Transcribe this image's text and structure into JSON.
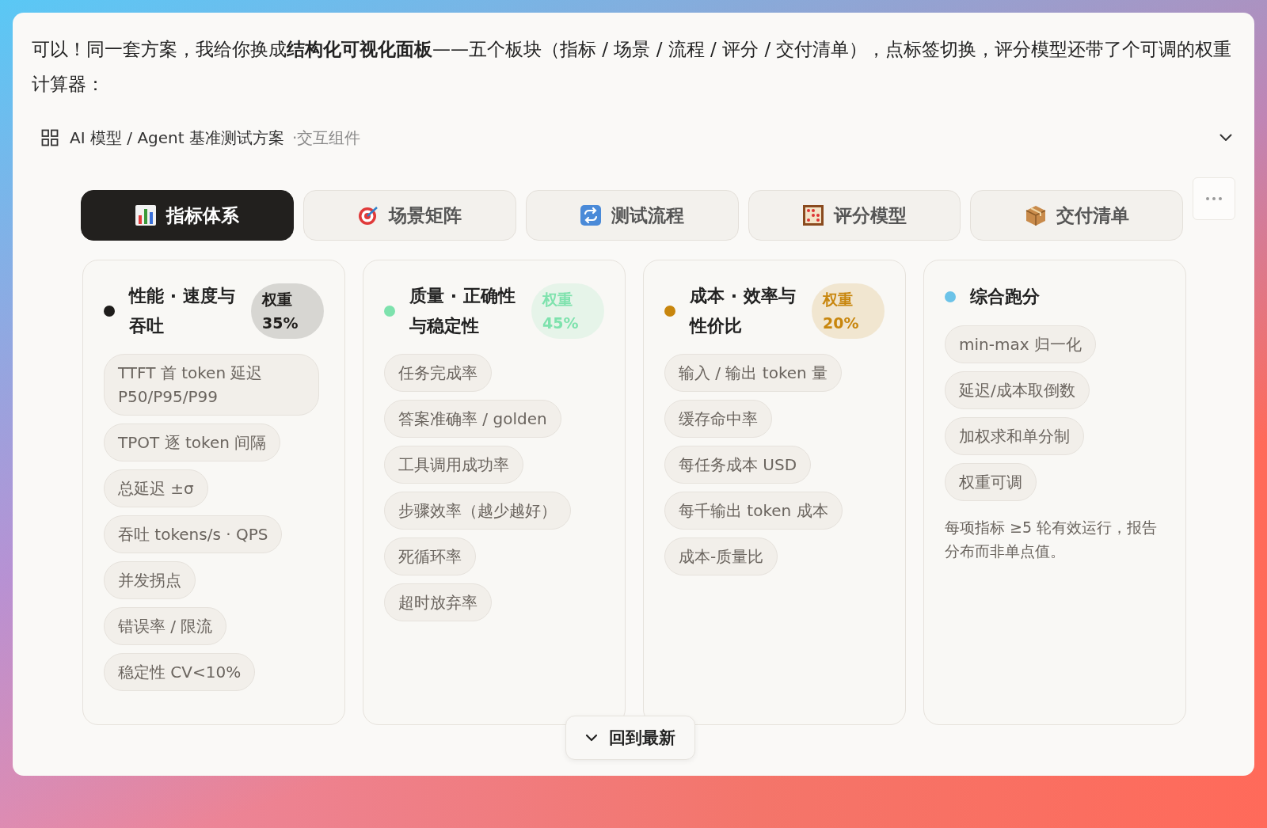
{
  "message": "可以！同一套方案，我给你换成**结构化可视化面板**——五个板块（指标 / 场景 / 流程 / 评分 / 交付清单），点标签切换，评分模型还带了个可调的权重计算器：",
  "widget": {
    "title": "AI 模型 / Agent 基准测试方案",
    "subtitle": "·交互组件"
  },
  "tabs": [
    {
      "label": "指标体系",
      "selected": true
    },
    {
      "label": "场景矩阵",
      "selected": false
    },
    {
      "label": "测试流程",
      "selected": false
    },
    {
      "label": "评分模型",
      "selected": false
    },
    {
      "label": "交付清单",
      "selected": false
    }
  ],
  "cards": [
    {
      "title": "性能 · 速度与吞吐",
      "color": "#1f1d1b",
      "weight": {
        "label": "权重",
        "value": "35%"
      },
      "chips": [
        "TTFT 首 token 延迟 P50/P95/P99",
        "TPOT 逐 token 间隔",
        "总延迟 ±σ",
        "吞吐 tokens/s · QPS",
        "并发拐点",
        "错误率 / 限流",
        "稳定性 CV<10%"
      ]
    },
    {
      "title": "质量 · 正确性与稳定性",
      "color": "#7ee2ad",
      "weight": {
        "label": "权重",
        "value": "45%"
      },
      "chips": [
        "任务完成率",
        "答案准确率 / golden",
        "工具调用成功率",
        "步骤效率（越少越好）",
        "死循环率",
        "超时放弃率"
      ]
    },
    {
      "title": "成本 · 效率与性价比",
      "color": "#c8860d",
      "weight": {
        "label": "权重",
        "value": "20%"
      },
      "chips": [
        "输入 / 输出 token 量",
        "缓存命中率",
        "每任务成本 USD",
        "每千输出 token 成本",
        "成本-质量比"
      ]
    },
    {
      "title": "综合跑分",
      "color": "#6cc3e8",
      "chips": [
        "min-max 归一化",
        "延迟/成本取倒数",
        "加权求和单分制",
        "权重可调"
      ],
      "note": "每项指标 ≥5 轮有效运行，报告分布而非单点值。"
    }
  ],
  "jump_button": {
    "label": "回到最新"
  }
}
